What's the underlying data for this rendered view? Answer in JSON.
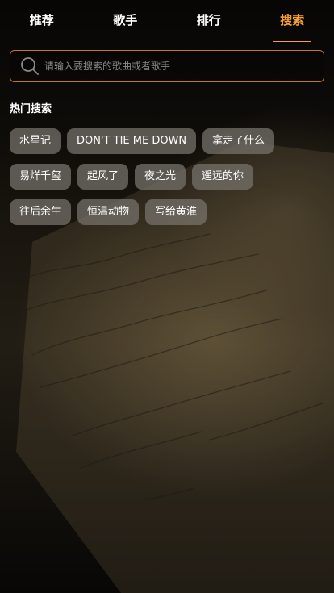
{
  "nav": {
    "tabs": [
      {
        "label": "推荐",
        "active": false
      },
      {
        "label": "歌手",
        "active": false
      },
      {
        "label": "排行",
        "active": false
      },
      {
        "label": "搜索",
        "active": true
      }
    ],
    "active_color": "#f7a233"
  },
  "search": {
    "placeholder": "请输入要搜索的歌曲或者歌手",
    "icon": "search-icon",
    "border_color": "#c7782c"
  },
  "hot_search": {
    "title": "热门搜索",
    "rows": [
      [
        "水星记",
        "DON'T TIE ME DOWN",
        "拿走了什么"
      ],
      [
        "易烊千玺",
        "起风了",
        "夜之光",
        "遥远的你"
      ],
      [
        "往后余生",
        "恒温动物",
        "写给黄淮"
      ]
    ]
  }
}
